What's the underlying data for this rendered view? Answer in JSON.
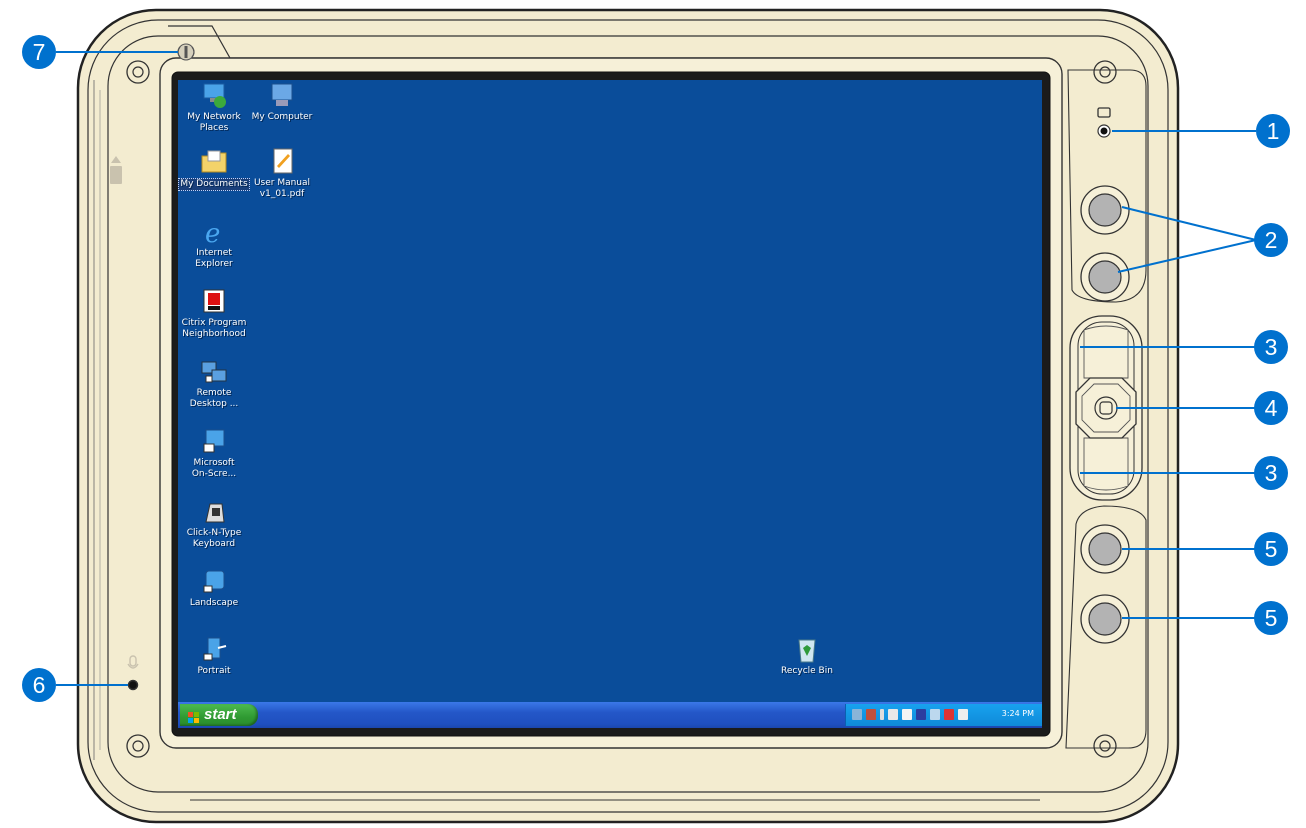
{
  "colors": {
    "bezel": "#f3ecd0",
    "outline": "#2a2a2a",
    "desktop": "#0a4d9a",
    "callout": "#0071ce",
    "button_fill": "#b3b3b3"
  },
  "callouts": [
    {
      "label": "1",
      "target": "status-indicator-light"
    },
    {
      "label": "2",
      "target": "upper-buttons"
    },
    {
      "label": "3",
      "target": "scroll-up-down-pad"
    },
    {
      "label": "4",
      "target": "center-select-button"
    },
    {
      "label": "3",
      "target": "scroll-up-down-pad"
    },
    {
      "label": "5",
      "target": "lower-buttons"
    },
    {
      "label": "5",
      "target": "lower-buttons"
    },
    {
      "label": "6",
      "target": "microphone"
    },
    {
      "label": "7",
      "target": "wireless-indicator"
    }
  ],
  "desktop": {
    "icons": [
      {
        "label": "My Network\nPlaces",
        "icon": "network-places-icon"
      },
      {
        "label": "My Computer",
        "icon": "computer-icon"
      },
      {
        "label": "My Documents",
        "icon": "documents-folder-icon",
        "selected": true
      },
      {
        "label": "User Manual\nv1_01.pdf",
        "icon": "pdf-document-icon"
      },
      {
        "label": "Internet\nExplorer",
        "icon": "internet-explorer-icon"
      },
      {
        "label": "Citrix Program\nNeighborhood",
        "icon": "citrix-icon"
      },
      {
        "label": "Remote\nDesktop ...",
        "icon": "remote-desktop-icon"
      },
      {
        "label": "Microsoft\nOn-Scre...",
        "icon": "on-screen-keyboard-icon"
      },
      {
        "label": "Click-N-Type\nKeyboard",
        "icon": "keyboard-icon"
      },
      {
        "label": "Landscape",
        "icon": "landscape-icon"
      },
      {
        "label": "Portrait",
        "icon": "portrait-icon"
      },
      {
        "label": "Recycle Bin",
        "icon": "recycle-bin-icon"
      }
    ],
    "taskbar": {
      "start_label": "start",
      "clock": "3:24 PM"
    }
  }
}
